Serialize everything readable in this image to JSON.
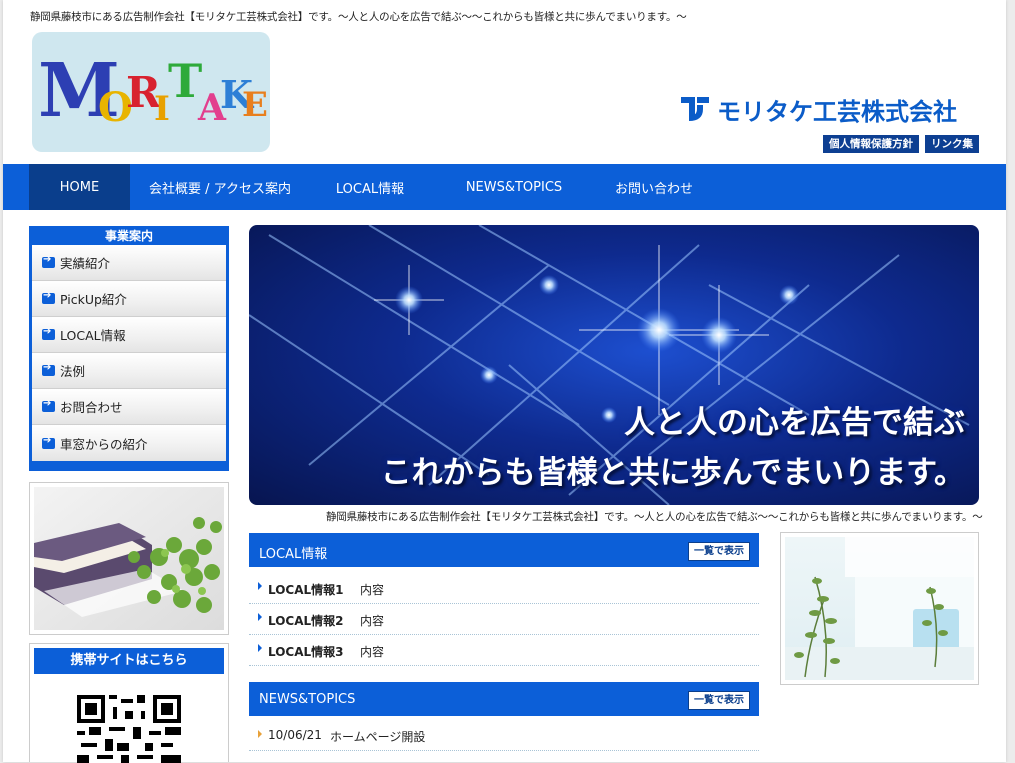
{
  "header": {
    "tagline": "静岡県藤枝市にある広告制作会社【モリタケ工芸株式会社】です。〜人と人の心を広告で結ぶ〜〜これからも皆様と共に歩んでまいります。〜",
    "logo_letters": [
      "M",
      "O",
      "R",
      "I",
      "T",
      "A",
      "K",
      "E"
    ],
    "company_name": "モリタケ工芸株式会社",
    "top_links": [
      "個人情報保護方針",
      "リンク集"
    ]
  },
  "nav": {
    "items": [
      "HOME",
      "会社概要 / アクセス案内",
      "LOCAL情報",
      "NEWS&TOPICS",
      "お問い合わせ"
    ]
  },
  "sidebar": {
    "title": "事業案内",
    "items": [
      "実績紹介",
      "PickUp紹介",
      "LOCAL情報",
      "法例",
      "お問合わせ",
      "車窓からの紹介"
    ],
    "mobile_title": "携帯サイトはこちら"
  },
  "hero": {
    "line1": "人と人の心を広告で結ぶ",
    "line2": "これからも皆様と共に歩んでまいります。"
  },
  "subtagline": "静岡県藤枝市にある広告制作会社【モリタケ工芸株式会社】です。〜人と人の心を広告で結ぶ〜〜これからも皆様と共に歩んでまいります。〜",
  "local": {
    "title": "LOCAL情報",
    "more": "一覧で表示",
    "rows": [
      {
        "label": "LOCAL情報1",
        "value": "内容"
      },
      {
        "label": "LOCAL情報2",
        "value": "内容"
      },
      {
        "label": "LOCAL情報3",
        "value": "内容"
      }
    ]
  },
  "news": {
    "title": "NEWS&TOPICS",
    "more": "一覧で表示",
    "rows": [
      {
        "date": "10/06/21",
        "value": "ホームページ開設"
      }
    ]
  },
  "colors": {
    "primary": "#0c5fd8",
    "dark": "#0a3e8c"
  }
}
